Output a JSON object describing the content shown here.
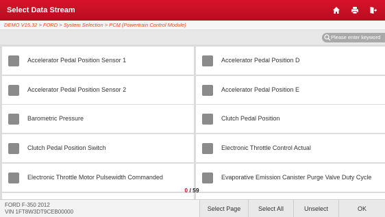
{
  "header": {
    "title": "Select Data Stream",
    "accent_color": "#c8102e"
  },
  "breadcrumb": "DEMO V15.32 > FORD > System Selection > PCM (Powertrain Control Module)",
  "search": {
    "placeholder": "Please enter keyword"
  },
  "items": [
    {
      "left": "Accelerator Pedal Position Sensor 1",
      "right": "Accelerator Pedal Position D"
    },
    {
      "left": "Accelerator Pedal Position Sensor 2",
      "right": "Accelerator Pedal Position E"
    },
    {
      "left": "Barometric Pressure",
      "right": "Clutch Pedal Position"
    },
    {
      "left": "Clutch Pedal Position Switch",
      "right": "Electronic Throttle Control Actual"
    },
    {
      "left": "Electronic Throttle Motor Pulsewidth Commanded",
      "right": "Evaporative Emission Canister Purge Valve Duty Cycle"
    }
  ],
  "pager": {
    "selected": "0",
    "total": "/ 59"
  },
  "vehicle": {
    "model": "FORD F-350 2012",
    "vin": "VIN 1FT8W3DT9CEB00000"
  },
  "footer": {
    "select_page": "Select Page",
    "select_all": "Select All",
    "unselect": "Unselect",
    "ok": "OK"
  },
  "icons": {
    "home": "home-icon",
    "print": "print-icon",
    "exit": "exit-icon",
    "search": "search-icon"
  }
}
